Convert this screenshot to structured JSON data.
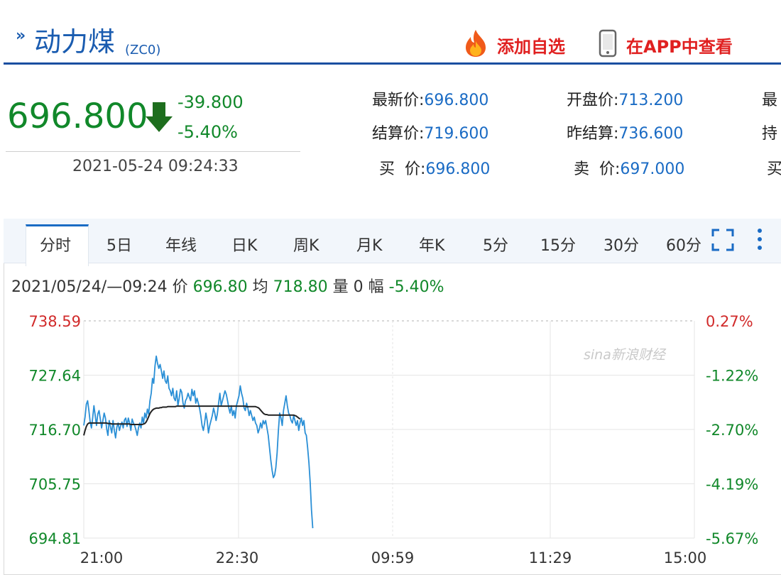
{
  "header": {
    "title_arrows": "»",
    "title": "动力煤",
    "code": "(ZC0)",
    "add_watchlist": "添加自选",
    "view_in_app": "在APP中查看",
    "accent_color": "#1a5cb0",
    "action_color": "#e02020"
  },
  "quote": {
    "price": "696.800",
    "change": "-39.800",
    "change_pct": "-5.40%",
    "time": "2021-05-24 09:24:33",
    "down_color": "#11882a",
    "fields": [
      {
        "label": "最新价:",
        "value": "696.800"
      },
      {
        "label": "开盘价:",
        "value": "713.200"
      },
      {
        "label": "最",
        "value": ""
      },
      {
        "label": "结算价:",
        "value": "719.600"
      },
      {
        "label": "昨结算:",
        "value": "736.600"
      },
      {
        "label": "持",
        "value": ""
      },
      {
        "label": "买  价:",
        "value": "696.800"
      },
      {
        "label": "卖  价:",
        "value": "697.000"
      },
      {
        "label": "买",
        "value": ""
      }
    ]
  },
  "tabs": [
    "分时",
    "5日",
    "年线",
    "日K",
    "周K",
    "月K",
    "年K",
    "5分",
    "15分",
    "30分",
    "60分"
  ],
  "active_tab": "分时",
  "info": {
    "datetime": "2021/05/24/—09:24",
    "price_label": "价",
    "price": "696.80",
    "avg_label": "均",
    "avg": "718.80",
    "vol_label": "量",
    "vol": "0",
    "amp_label": "幅",
    "amp": "-5.40%"
  },
  "watermark": "sina新浪财经",
  "chart_data": {
    "type": "line",
    "x_ticks": [
      "21:00",
      "22:30",
      "09:59",
      "11:29",
      "15:00"
    ],
    "y_left_ticks": [
      "738.59",
      "727.64",
      "716.70",
      "705.75",
      "694.81"
    ],
    "y_right_ticks": [
      "0.27%",
      "-1.22%",
      "-2.70%",
      "-4.19%",
      "-5.67%"
    ],
    "ylim": [
      694.81,
      738.59
    ],
    "reference_price": 736.6,
    "series": [
      {
        "name": "价",
        "color": "#2a8fd6",
        "values": [
          717.5,
          719.2,
          721.8,
          722.5,
          720.5,
          718.2,
          717.0,
          719.0,
          721.5,
          719.5,
          717.5,
          719.8,
          720.5,
          718.8,
          717.0,
          718.5,
          720.0,
          719.0,
          716.8,
          715.5,
          718.5,
          717.2,
          716.0,
          718.5,
          716.5,
          715.0,
          717.2,
          718.0,
          716.5,
          717.5,
          718.2,
          717.0,
          718.6,
          719.0,
          717.3,
          719.0,
          718.0,
          716.5,
          718.8,
          718.0,
          717.5,
          716.6,
          715.5,
          717.0,
          718.0,
          717.0,
          719.2,
          718.0,
          720.0,
          719.0,
          720.8,
          719.8,
          722.5,
          724.0,
          727.0,
          726.0,
          729.5,
          731.5,
          730.0,
          729.0,
          729.8,
          728.5,
          727.0,
          728.5,
          726.5,
          726.0,
          727.5,
          725.0,
          724.5,
          723.5,
          725.0,
          723.0,
          722.5,
          724.5,
          721.5,
          723.0,
          724.8,
          724.2,
          722.0,
          721.0,
          722.5,
          723.0,
          724.0,
          723.2,
          722.5,
          724.8,
          723.5,
          724.5,
          722.0,
          723.0,
          722.0,
          721.0,
          719.5,
          717.5,
          716.5,
          718.0,
          720.0,
          718.5,
          716.0,
          717.5,
          718.5,
          719.5,
          721.0,
          720.0,
          718.5,
          719.8,
          722.0,
          724.0,
          721.5,
          722.5,
          723.5,
          724.5,
          723.8,
          722.5,
          721.0,
          720.0,
          721.5,
          719.5,
          720.5,
          719.0,
          721.5,
          722.5,
          723.5,
          725.5,
          724.0,
          723.0,
          721.0,
          720.5,
          722.0,
          721.0,
          719.5,
          720.5,
          719.5,
          718.5,
          719.2,
          718.0,
          717.5,
          716.0,
          716.8,
          718.0,
          717.0,
          718.5,
          717.8,
          718.5,
          717.0,
          715.5,
          713.0,
          710.5,
          708.5,
          707.0,
          707.5,
          709.0,
          712.0,
          716.5,
          720.0,
          719.0,
          717.5,
          720.5,
          722.0,
          723.5,
          721.5,
          720.0,
          719.5,
          718.5,
          718.0,
          719.5,
          718.5,
          717.5,
          718.5,
          716.5,
          718.0,
          719.0,
          717.5,
          718.5,
          716.0,
          715.5,
          713.0,
          710.0,
          706.0,
          700.5,
          696.8
        ]
      },
      {
        "name": "均",
        "color": "#222222",
        "values": [
          715.5,
          716.5,
          717.3,
          717.8,
          718.0,
          718.0,
          718.0,
          718.0,
          718.0,
          718.0,
          718.0,
          718.0,
          718.0,
          718.0,
          718.0,
          718.0,
          718.0,
          718.0,
          718.0,
          717.9,
          717.9,
          717.9,
          717.8,
          717.8,
          717.8,
          717.8,
          717.8,
          717.8,
          717.8,
          717.8,
          717.8,
          717.8,
          717.8,
          717.8,
          717.8,
          717.8,
          717.8,
          717.7,
          717.7,
          717.7,
          717.7,
          717.7,
          717.7,
          717.7,
          717.7,
          717.7,
          717.7,
          717.8,
          717.9,
          718.2,
          718.7,
          719.3,
          719.9,
          720.3,
          720.6,
          720.8,
          720.9,
          721.0,
          721.0,
          721.0,
          721.1,
          721.1,
          721.2,
          721.2,
          721.2,
          721.2,
          721.3,
          721.3,
          721.3,
          721.3,
          721.3,
          721.3,
          721.3,
          721.4,
          721.4,
          721.4,
          721.4,
          721.4,
          721.4,
          721.4,
          721.4,
          721.4,
          721.4,
          721.4,
          721.4,
          721.4,
          721.4,
          721.4,
          721.4,
          721.4,
          721.4,
          721.4,
          721.4,
          721.4,
          721.4,
          721.4,
          721.4,
          721.4,
          721.4,
          721.4,
          721.4,
          721.4,
          721.4,
          721.4,
          721.4,
          721.4,
          721.4,
          721.4,
          721.4,
          721.4,
          721.4,
          721.4,
          721.4,
          721.4,
          721.4,
          721.4,
          721.4,
          721.4,
          721.4,
          721.4,
          721.4,
          721.4,
          721.4,
          721.4,
          721.4,
          721.4,
          721.4,
          721.4,
          721.3,
          721.3,
          721.3,
          721.3,
          721.3,
          721.3,
          721.3,
          721.3,
          721.2,
          721.1,
          720.9,
          720.6,
          720.3,
          720.0,
          719.8,
          719.7,
          719.7,
          719.6,
          719.6,
          719.6,
          719.6,
          719.6,
          719.6,
          719.6,
          719.6,
          719.6,
          719.6,
          719.6,
          719.6,
          719.6,
          719.6,
          719.6,
          719.6,
          719.6,
          719.6,
          719.6,
          719.6,
          719.6,
          719.5,
          719.4,
          719.2,
          719.0,
          718.8
        ]
      }
    ]
  }
}
